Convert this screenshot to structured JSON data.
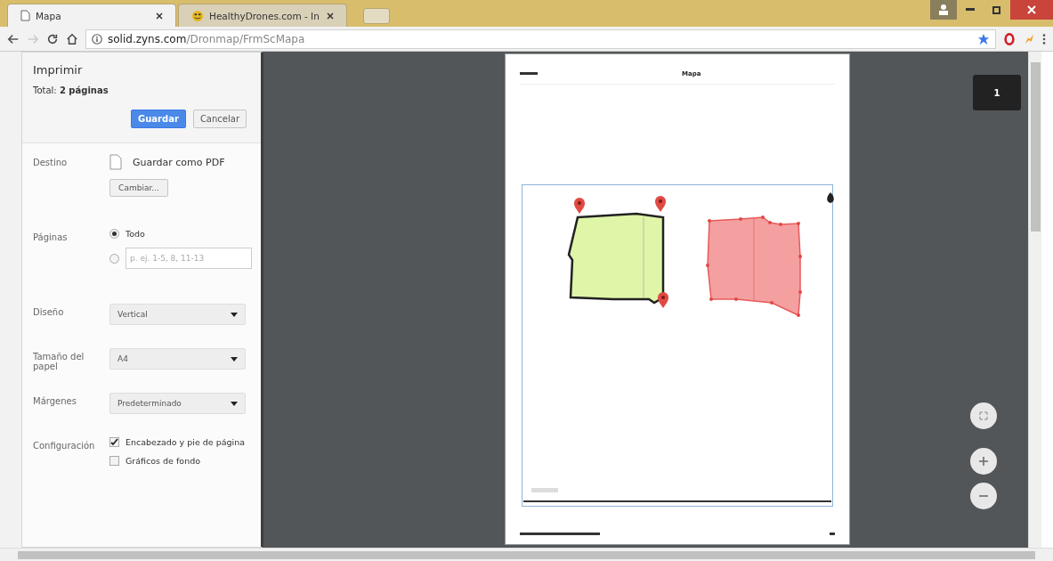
{
  "browser": {
    "tabs": [
      {
        "title": "Mapa",
        "selected": true
      },
      {
        "title": "HealthyDrones.com - In",
        "selected": false
      }
    ],
    "url_host": "solid.zyns.com",
    "url_path": "/Dronmap/FrmScMapa"
  },
  "print_panel": {
    "title": "Imprimir",
    "total": "Total: **2 páginas**",
    "buttons": [
      {
        "label": "Guardar",
        "kind": "primary"
      },
      {
        "label": "Cancelar",
        "kind": "secondary"
      }
    ],
    "settings": [
      {
        "kind": "destination",
        "label": "Destino",
        "value": "Guardar como PDF",
        "button": "Cambiar..."
      },
      {
        "kind": "pages",
        "label": "Páginas",
        "options": [
          {
            "label": "Todo",
            "selected": true
          },
          {
            "placeholder": "p. ej. 1-5, 8, 11-13",
            "selected": false
          }
        ]
      },
      {
        "kind": "select",
        "label": "Diseño",
        "value": "Vertical"
      },
      {
        "kind": "select",
        "label": "Tamaño del papel",
        "value": "A4"
      },
      {
        "kind": "select",
        "label": "Márgenes",
        "value": "Predeterminado"
      },
      {
        "kind": "checkboxes",
        "label": "Configuración",
        "options": [
          {
            "label": "Encabezado y pie de página",
            "checked": true
          },
          {
            "label": "Gráficos de fondo",
            "checked": false
          }
        ]
      }
    ]
  },
  "preview": {
    "page_indicator": "1",
    "page_title": "Mapa"
  }
}
